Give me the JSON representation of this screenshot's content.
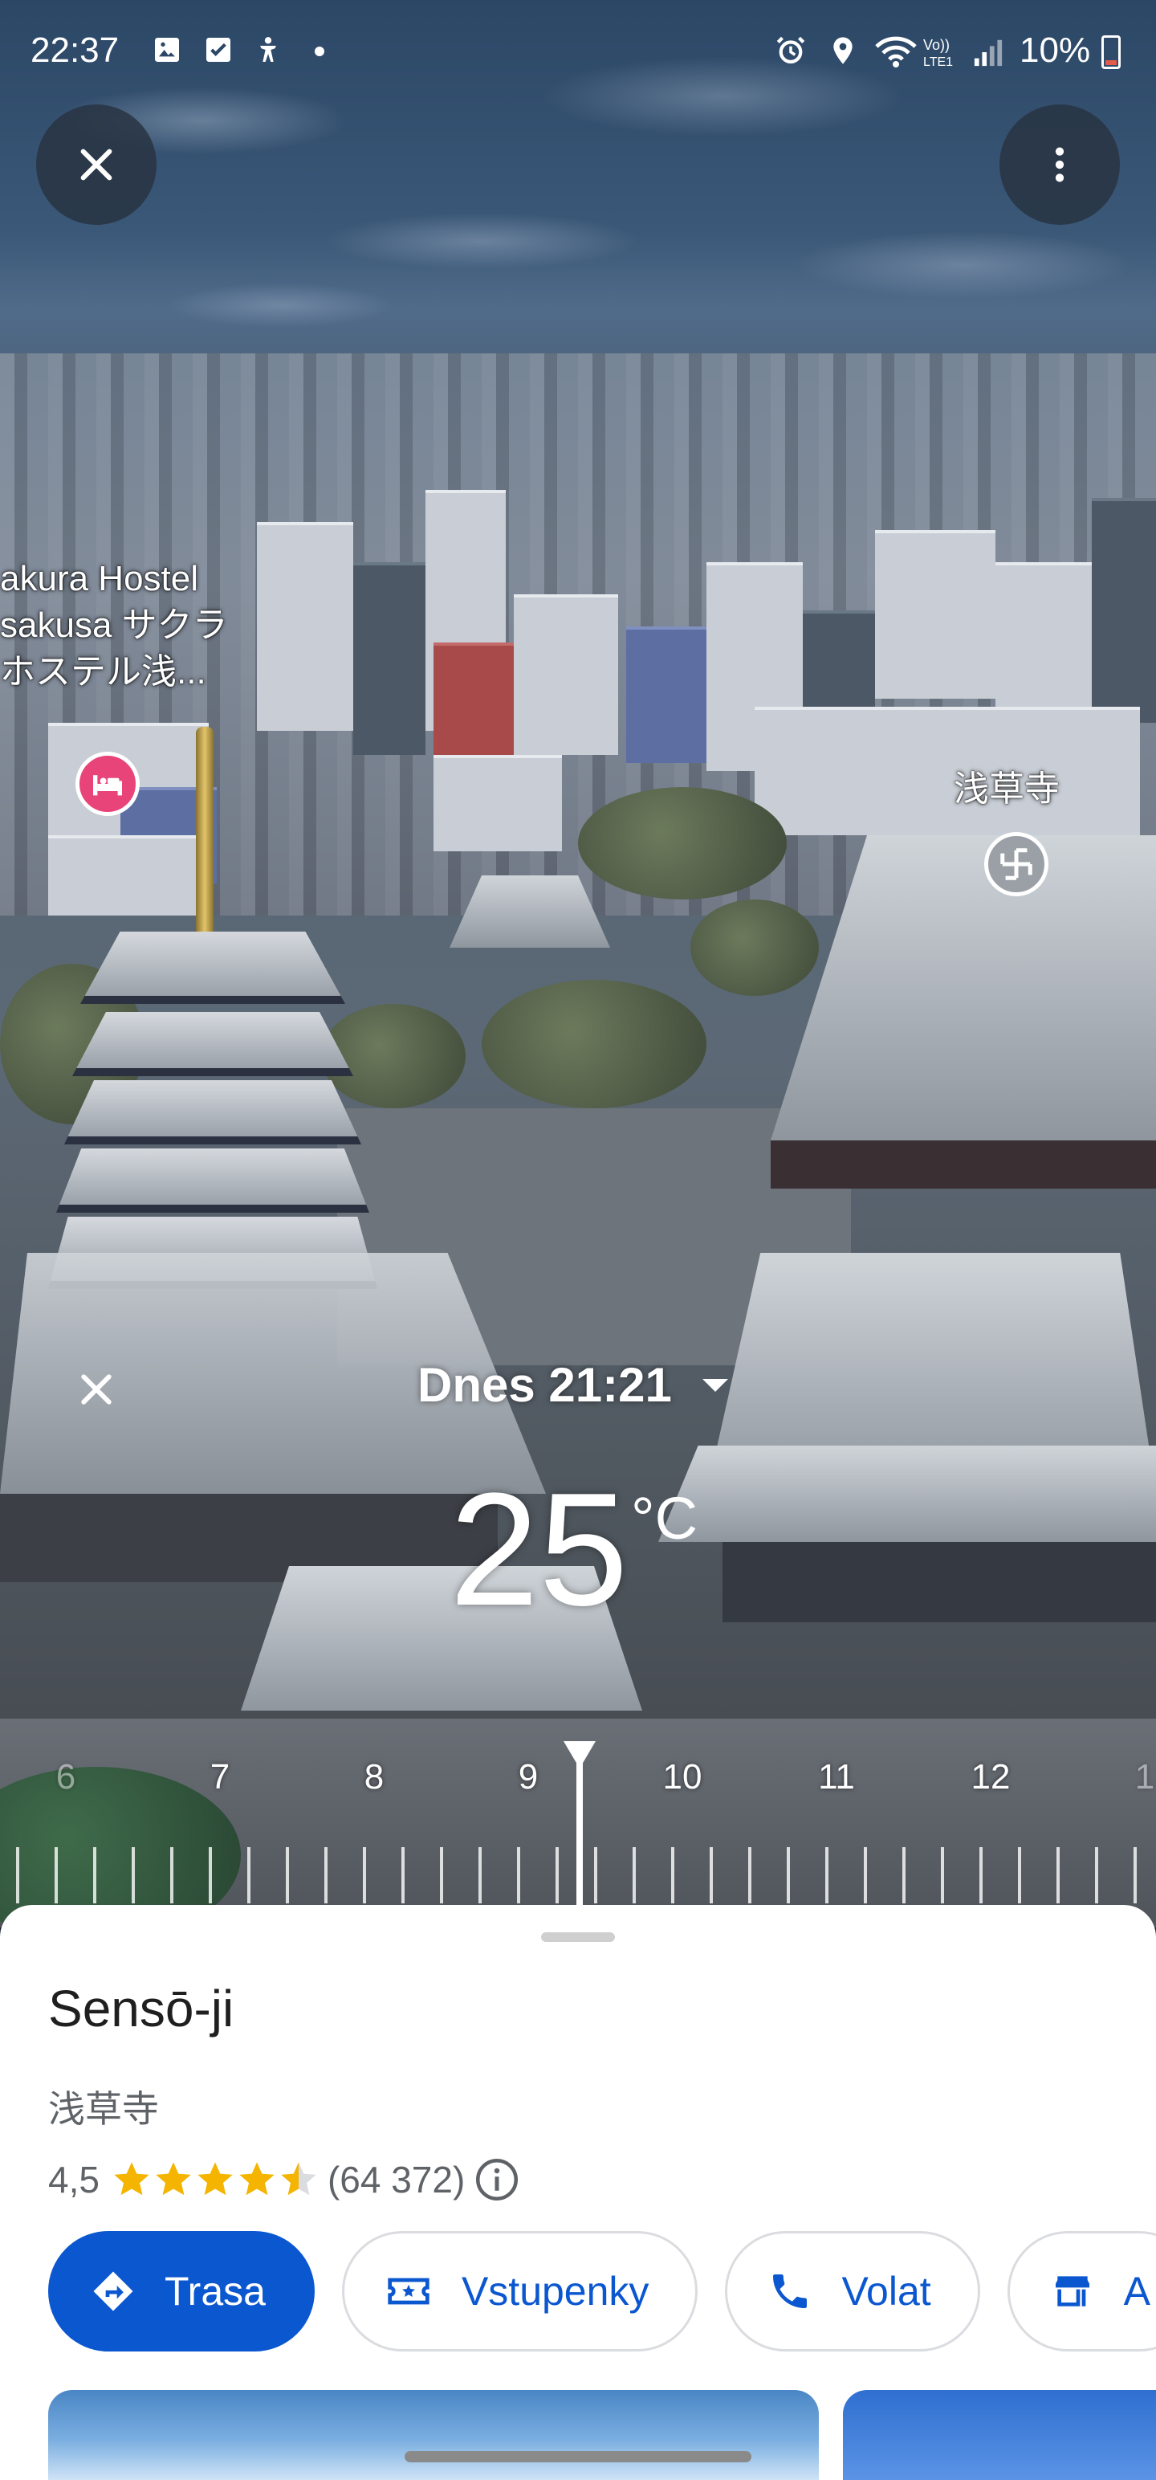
{
  "status_bar": {
    "time": "22:37",
    "battery": "10%",
    "icons": [
      "gallery-icon",
      "checkbox-icon",
      "accessibility-icon",
      "dot-icon",
      "alarm-icon",
      "location-icon",
      "wifi-icon",
      "volte-icon",
      "signal-icon",
      "battery-icon"
    ]
  },
  "map": {
    "labels": {
      "hostel": "akura Hostel\nsakusa サクラ\nホステル浅...",
      "temple": "浅草寺"
    },
    "pins": [
      "hotel-icon",
      "temple-icon"
    ]
  },
  "weather": {
    "time_label": "Dnes 21:21",
    "temperature": "25",
    "unit": "°C",
    "timeline": {
      "labels": [
        "6",
        "7",
        "8",
        "9",
        "10",
        "11",
        "12",
        "1"
      ],
      "selected_hour_fraction": 0.33
    }
  },
  "place": {
    "title": "Sensō-ji",
    "subtitle": "浅草寺",
    "rating": "4,5",
    "rating_value": 4.5,
    "review_count": "(64 372)",
    "actions": [
      {
        "label": "Trasa",
        "icon": "directions-icon"
      },
      {
        "label": "Vstupenky",
        "icon": "ticket-icon"
      },
      {
        "label": "Volat",
        "icon": "phone-icon"
      },
      {
        "label": "A",
        "icon": "store-icon"
      }
    ]
  },
  "colors": {
    "primary": "#0b57d0",
    "star": "#f4b400",
    "hotel_pin": "#e8447a",
    "temple_pin": "#9aa0a6"
  }
}
